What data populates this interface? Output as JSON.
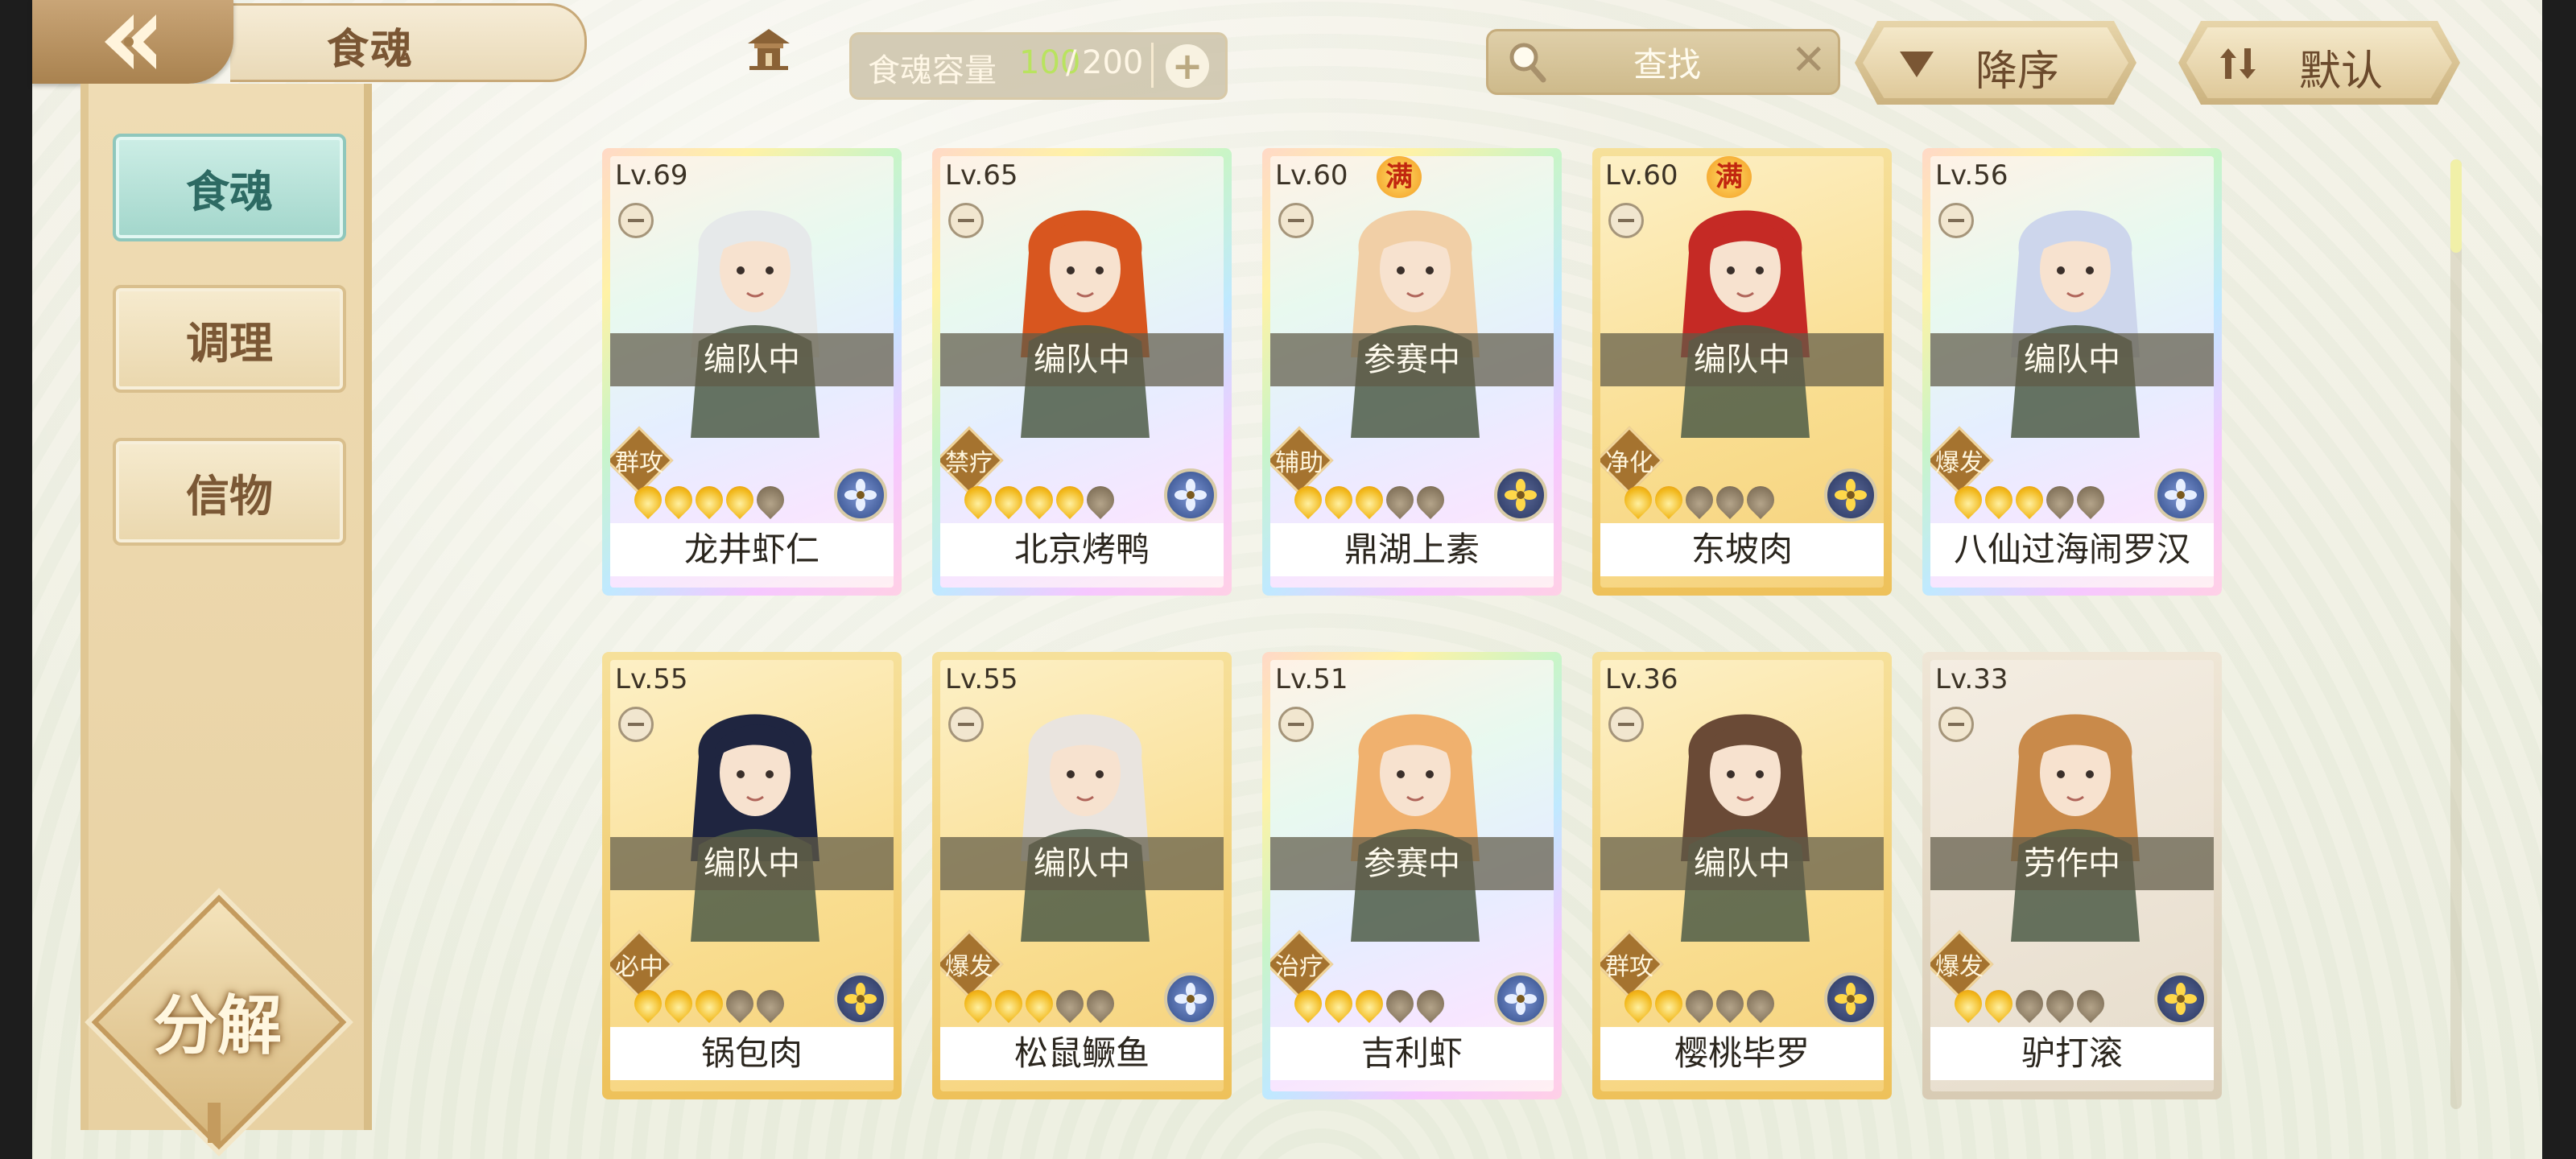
{
  "header": {
    "title": "食魂",
    "capacity": {
      "label": "食魂容量",
      "current": "100",
      "max": "200"
    },
    "search": {
      "label": "查找"
    },
    "sort_label": "降序",
    "filter_label": "默认"
  },
  "sidebar": {
    "tabs": [
      {
        "label": "食魂",
        "active": true
      },
      {
        "label": "调理",
        "active": false
      },
      {
        "label": "信物",
        "active": false
      }
    ],
    "decompose_label": "分解"
  },
  "cards": [
    {
      "level": "Lv.69",
      "name": "龙井虾仁",
      "status": "编队中",
      "role": "群攻",
      "flames_on": 4,
      "frame": "rainbow",
      "element": "blue",
      "max_badge": ""
    },
    {
      "level": "Lv.65",
      "name": "北京烤鸭",
      "status": "编队中",
      "role": "禁疗",
      "flames_on": 4,
      "frame": "rainbow",
      "element": "blue",
      "max_badge": ""
    },
    {
      "level": "Lv.60",
      "name": "鼎湖上素",
      "status": "参赛中",
      "role": "辅助",
      "flames_on": 3,
      "frame": "rainbow",
      "element": "gold",
      "max_badge": "满"
    },
    {
      "level": "Lv.60",
      "name": "东坡肉",
      "status": "编队中",
      "role": "净化",
      "flames_on": 2,
      "frame": "gold",
      "element": "gold",
      "max_badge": "满"
    },
    {
      "level": "Lv.56",
      "name": "八仙过海闹罗汉",
      "status": "编队中",
      "role": "爆发",
      "flames_on": 3,
      "frame": "rainbow",
      "element": "blue",
      "max_badge": ""
    },
    {
      "level": "Lv.55",
      "name": "锅包肉",
      "status": "编队中",
      "role": "必中",
      "flames_on": 3,
      "frame": "gold",
      "element": "gold",
      "max_badge": ""
    },
    {
      "level": "Lv.55",
      "name": "松鼠鳜鱼",
      "status": "编队中",
      "role": "爆发",
      "flames_on": 3,
      "frame": "gold",
      "element": "blue",
      "max_badge": ""
    },
    {
      "level": "Lv.51",
      "name": "吉利虾",
      "status": "参赛中",
      "role": "治疗",
      "flames_on": 3,
      "frame": "rainbow",
      "element": "blue",
      "max_badge": ""
    },
    {
      "level": "Lv.36",
      "name": "樱桃毕罗",
      "status": "编队中",
      "role": "群攻",
      "flames_on": 2,
      "frame": "gold",
      "element": "gold",
      "max_badge": ""
    },
    {
      "level": "Lv.33",
      "name": "驴打滚",
      "status": "劳作中",
      "role": "爆发",
      "flames_on": 2,
      "frame": "plain",
      "element": "gold",
      "max_badge": ""
    }
  ],
  "colors": {
    "accent_green": "#b9e35f",
    "active_tab": "#a2d6cb",
    "max_badge": "#c1260f"
  }
}
